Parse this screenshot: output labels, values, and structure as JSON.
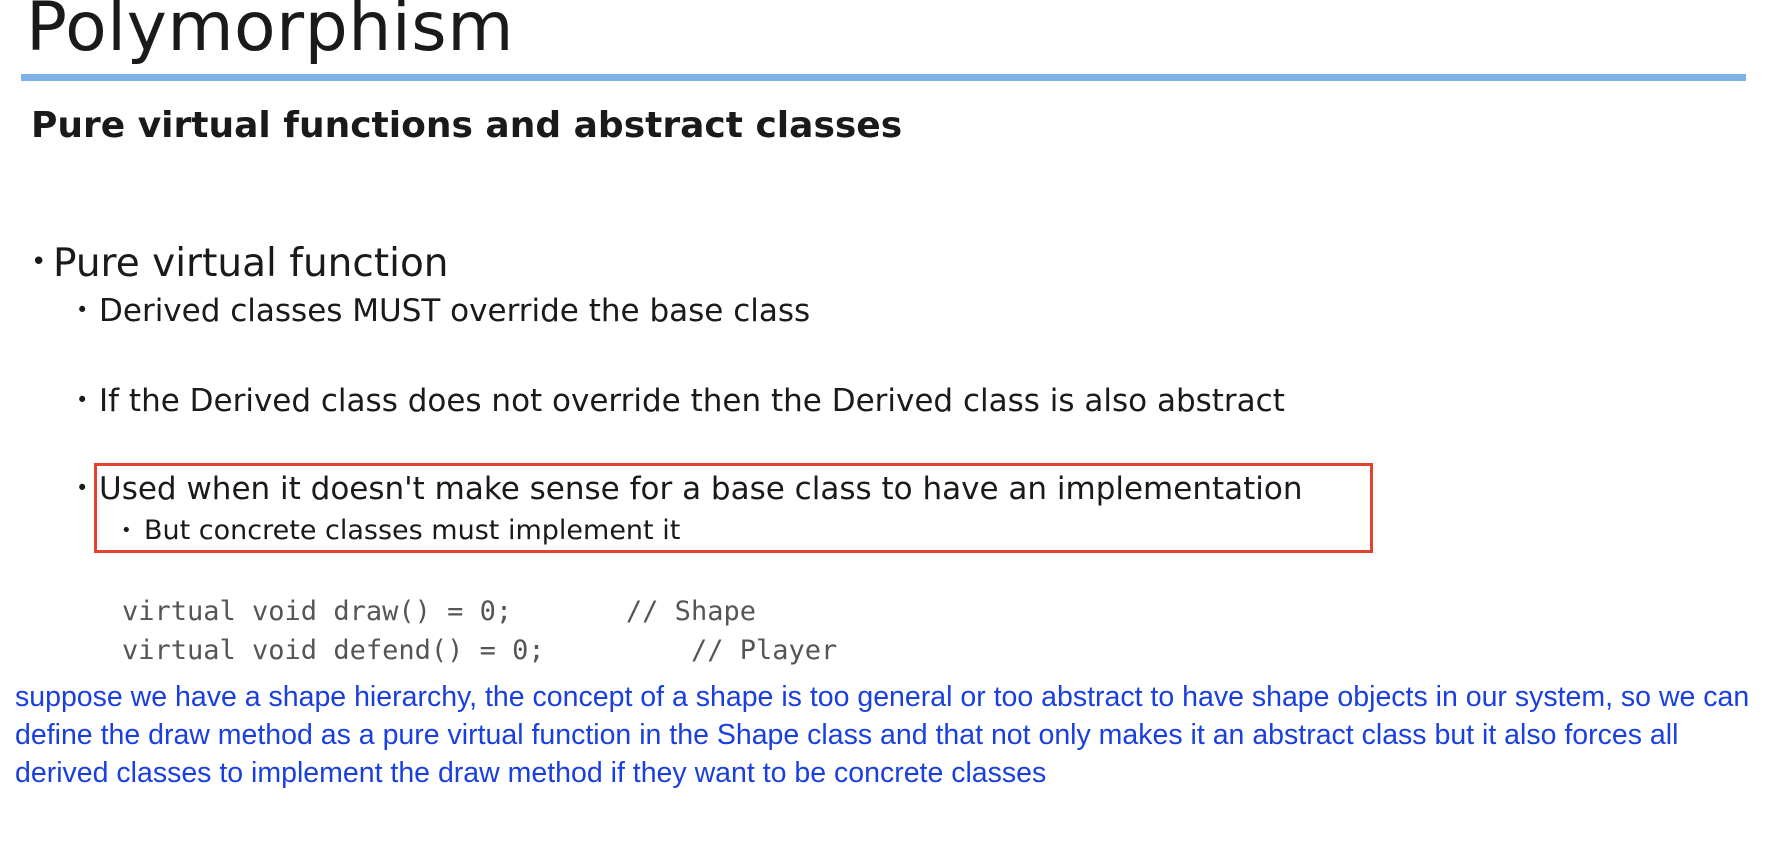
{
  "slide": {
    "title": "Polymorphism",
    "subtitle": "Pure virtual functions and abstract classes",
    "accent_color": "#7fb1e6",
    "highlight_color": "#e2432a",
    "note_color": "#1a3fe0"
  },
  "bullets": {
    "main": "Pure virtual function",
    "sub1": "Derived classes MUST override the base class",
    "sub2": "If the Derived class does not override then the Derived class is also abstract",
    "sub3": "Used when it doesn't make sense for a base class to have an implementation",
    "sub3_child": "But concrete classes must implement it"
  },
  "code": {
    "line1": "virtual void draw() = 0;       // Shape",
    "line2": "virtual void defend() = 0;         // Player"
  },
  "note": {
    "text": "suppose we have a shape hierarchy, the concept of a shape is too general or too abstract to have shape objects in our system, so we can define the draw method as a pure virtual function in the Shape class and that not only makes it an abstract class but it also forces all derived classes to implement the draw method if they want to be concrete classes"
  }
}
